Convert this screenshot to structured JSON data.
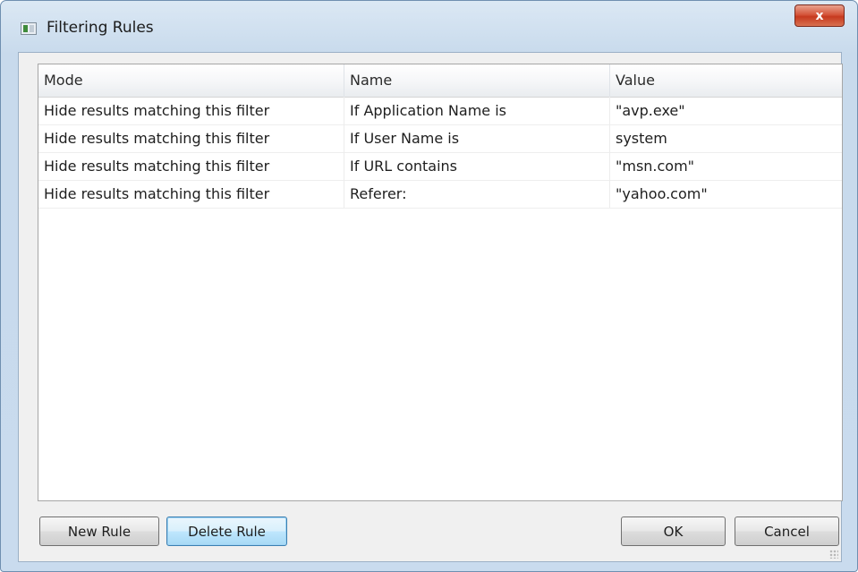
{
  "window": {
    "title": "Filtering Rules",
    "close_label": "x"
  },
  "table": {
    "columns": [
      "Mode",
      "Name",
      "Value"
    ],
    "rows": [
      {
        "mode": "Hide results matching this filter",
        "name": "If Application Name is",
        "value": "\"avp.exe\""
      },
      {
        "mode": "Hide results matching this filter",
        "name": "If User Name is",
        "value": "system"
      },
      {
        "mode": "Hide results matching this filter",
        "name": "If URL contains",
        "value": "\"msn.com\""
      },
      {
        "mode": "Hide results matching this filter",
        "name": "Referer:",
        "value": "\"yahoo.com\""
      }
    ]
  },
  "buttons": {
    "new_rule": "New Rule",
    "delete_rule": "Delete Rule",
    "ok": "OK",
    "cancel": "Cancel"
  },
  "icons": {
    "app": "app-window-icon",
    "close": "close-icon",
    "grip": "resize-grip-icon"
  },
  "colors": {
    "titlebar": "#c8daec",
    "close_button": "#d5553b",
    "focused_button": "#bee6fd"
  }
}
